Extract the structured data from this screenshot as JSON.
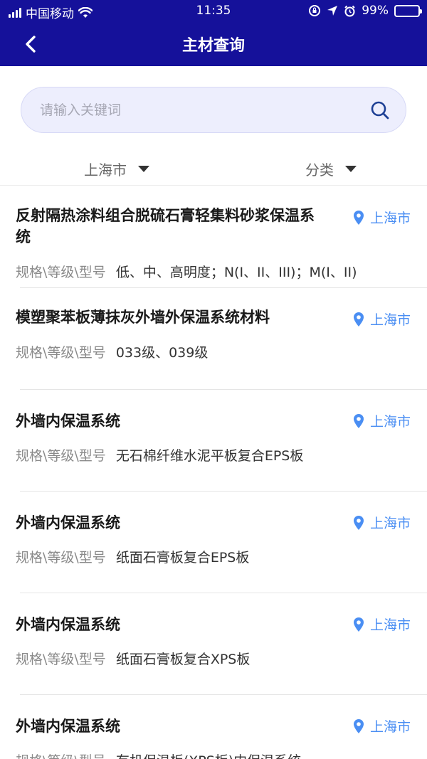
{
  "status": {
    "carrier": "中国移动",
    "time": "11:35",
    "battery": "99%"
  },
  "nav": {
    "title": "主材查询"
  },
  "search": {
    "placeholder": "请输入关键词"
  },
  "filters": {
    "region": "上海市",
    "category": "分类"
  },
  "spec_label": "规格\\等级\\型号",
  "items": [
    {
      "name": "反射隔热涂料组合脱硫石膏轻集料砂浆保温系统",
      "location": "上海市",
      "spec": "低、中、高明度；N(I、II、III)；M(I、II)"
    },
    {
      "name": "模塑聚苯板薄抹灰外墙外保温系统材料",
      "location": "上海市",
      "spec": "033级、039级"
    },
    {
      "name": "外墙内保温系统",
      "location": "上海市",
      "spec": "无石棉纤维水泥平板复合EPS板"
    },
    {
      "name": "外墙内保温系统",
      "location": "上海市",
      "spec": "纸面石膏板复合EPS板"
    },
    {
      "name": "外墙内保温系统",
      "location": "上海市",
      "spec": "纸面石膏板复合XPS板"
    },
    {
      "name": "外墙内保温系统",
      "location": "上海市",
      "spec": "有机保温板(XPS板)内保温系统"
    }
  ],
  "colors": {
    "header": "#15119a",
    "accent": "#4a8ef3",
    "search_bg": "#edeefd"
  },
  "icons": [
    "back-arrow-icon",
    "search-icon",
    "location-pin-icon",
    "dropdown-triangle-icon",
    "wifi-icon",
    "battery-icon"
  ]
}
